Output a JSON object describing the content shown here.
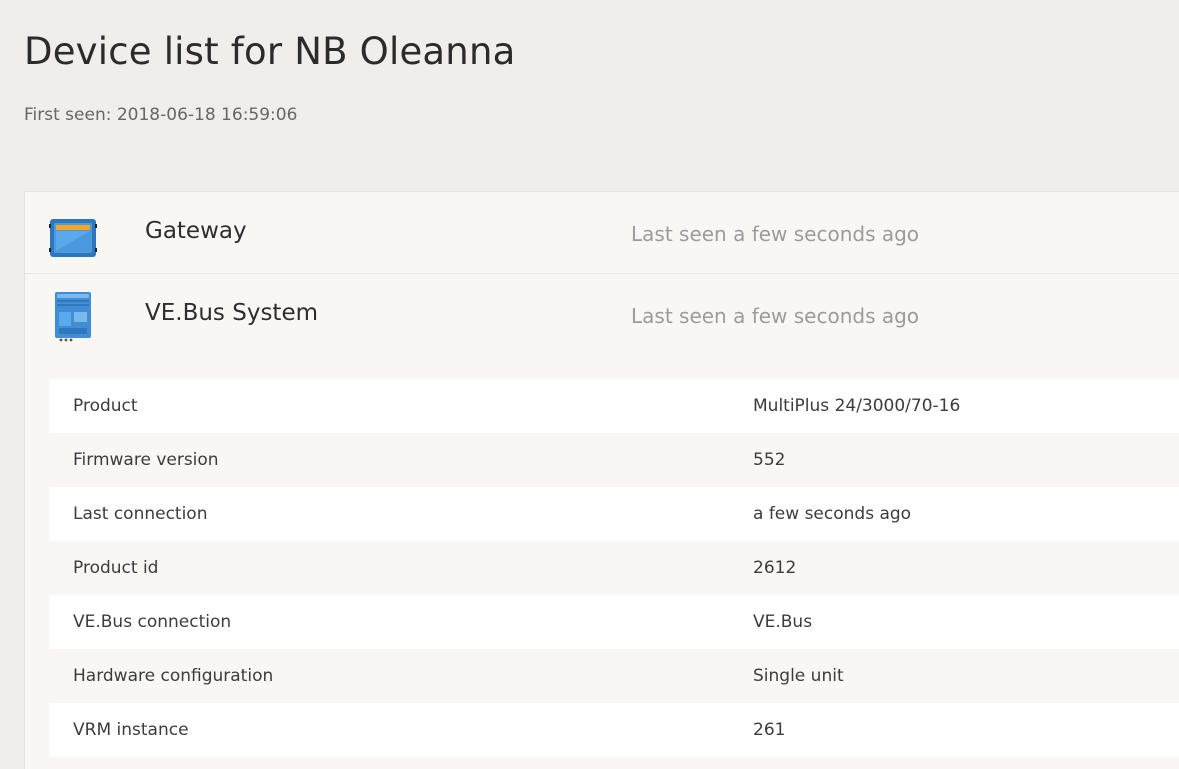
{
  "header": {
    "title": "Device list for NB Oleanna",
    "first_seen": "First seen: 2018-06-18 16:59:06"
  },
  "devices": [
    {
      "name": "Gateway",
      "last_seen": "Last seen a few seconds ago",
      "icon": "gateway-device-icon"
    },
    {
      "name": "VE.Bus System",
      "last_seen": "Last seen a few seconds ago",
      "icon": "multiplus-inverter-icon"
    }
  ],
  "details": [
    {
      "label": "Product",
      "value": "MultiPlus 24/3000/70-16"
    },
    {
      "label": "Firmware version",
      "value": "552"
    },
    {
      "label": "Last connection",
      "value": "a few seconds ago"
    },
    {
      "label": "Product id",
      "value": "2612"
    },
    {
      "label": "VE.Bus connection",
      "value": "VE.Bus"
    },
    {
      "label": "Hardware configuration",
      "value": "Single unit"
    },
    {
      "label": "VRM instance",
      "value": "261"
    }
  ],
  "colors": {
    "background": "#efeeeb",
    "device_blue": "#3f8ed6",
    "accent_orange": "#f5a623"
  }
}
